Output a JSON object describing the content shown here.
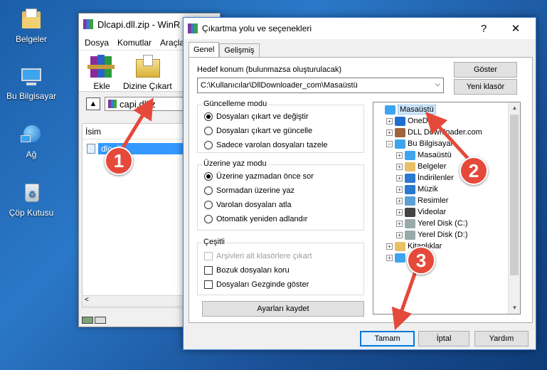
{
  "desktop": {
    "icons": [
      {
        "label": "Belgeler",
        "icon": "documents-folder-icon"
      },
      {
        "label": "Bu Bilgisayar",
        "icon": "computer-icon"
      },
      {
        "label": "Ağ",
        "icon": "network-icon"
      },
      {
        "label": "Çöp Kutusu",
        "icon": "recycle-bin-icon"
      }
    ]
  },
  "winrar": {
    "title": "Dlcapi.dll.zip - WinR",
    "menu": [
      "Dosya",
      "Komutlar",
      "Araçla"
    ],
    "tools": {
      "add": "Ekle",
      "extract_to": "Dizine Çıkart"
    },
    "address": "capi.dll.z",
    "column_name": "İsim",
    "file_name": "dlc    dll",
    "scroll_left": "<"
  },
  "dialog": {
    "title": "Çıkartma yolu ve seçenekleri",
    "help_symbol": "?",
    "close_symbol": "✕",
    "tabs": {
      "general": "Genel",
      "advanced": "Gelişmiş"
    },
    "target_label": "Hedef konum (bulunmazsa oluşturulacak)",
    "target_value": "C:\\Kullanıcılar\\DllDownloader_com\\Masaüstü",
    "show_button": "Göster",
    "new_folder_button": "Yeni klasör",
    "update_mode": {
      "title": "Güncelleme modu",
      "options": [
        "Dosyaları çıkart ve değiştir",
        "Dosyaları çıkart ve güncelle",
        "Sadece varolan dosyaları tazele"
      ],
      "selected": 0
    },
    "overwrite_mode": {
      "title": "Üzerine yaz modu",
      "options": [
        "Üzerine yazmadan önce sor",
        "Sormadan üzerine yaz",
        "Varolan dosyaları atla",
        "Otomatik yeniden adlandır"
      ],
      "selected": 0
    },
    "misc": {
      "title": "Çeşitli",
      "options": [
        "Arşivleri alt klasörlere çıkart",
        "Bozuk dosyaları koru",
        "Dosyaları Gezginde göster"
      ]
    },
    "save_settings_button": "Ayarları kaydet",
    "tree": [
      {
        "label": "Masaüstü",
        "level": 0,
        "expander": "",
        "selected": true
      },
      {
        "label": "OneDrive",
        "level": 1,
        "expander": "+"
      },
      {
        "label": "DLL Downloader.com",
        "level": 1,
        "expander": "+"
      },
      {
        "label": "Bu Bilgisayar",
        "level": 1,
        "expander": "−"
      },
      {
        "label": "Masaüstü",
        "level": 2,
        "expander": "+"
      },
      {
        "label": "Belgeler",
        "level": 2,
        "expander": "+"
      },
      {
        "label": "İndirilenler",
        "level": 2,
        "expander": "+"
      },
      {
        "label": "Müzik",
        "level": 2,
        "expander": "+"
      },
      {
        "label": "Resimler",
        "level": 2,
        "expander": "+"
      },
      {
        "label": "Videolar",
        "level": 2,
        "expander": "+"
      },
      {
        "label": "Yerel Disk (C:)",
        "level": 2,
        "expander": "+"
      },
      {
        "label": "Yerel Disk (D:)",
        "level": 2,
        "expander": "+"
      },
      {
        "label": "Kitaplıklar",
        "level": 1,
        "expander": "+"
      },
      {
        "label": "A",
        "level": 1,
        "expander": "+"
      }
    ],
    "ok_button": "Tamam",
    "cancel_button": "İptal",
    "help_button": "Yardım"
  },
  "annotations": [
    "1",
    "2",
    "3"
  ],
  "colors": {
    "badge": "#e5493a",
    "selection": "#3399ff",
    "accent": "#0078d7"
  }
}
